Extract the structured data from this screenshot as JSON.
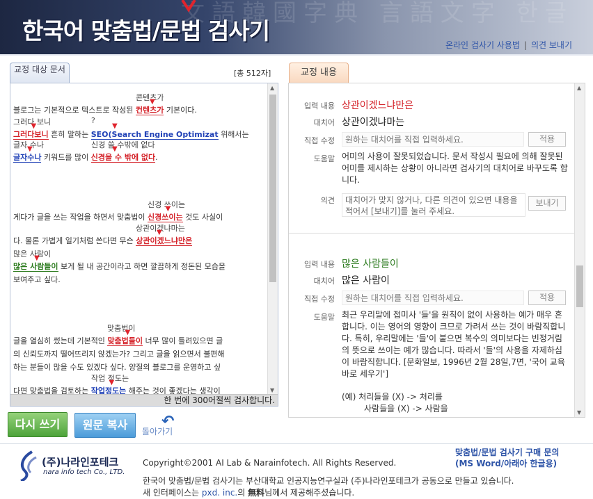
{
  "header": {
    "title_a": "한국어 ",
    "title_b": "맞춤법/문법 검사기",
    "bg_text": "文語韓國字典 言語文字 한글",
    "links": {
      "help": "온라인 검사기 사용법",
      "sep": "|",
      "feedback": "의견 보내기"
    }
  },
  "left": {
    "tab_label": "교정 대상 문서",
    "count": "[총 512자]",
    "status": "한 번에 300어절씩 검사합니다.",
    "lines": [
      {
        "pre": "블로그는 기본적으로 텍스트로 작성된 ",
        "err": "컨텐츠가",
        "type": "red",
        "post": " 기본이다.",
        "sug": "콘텐츠가"
      },
      {
        "pre": "",
        "err": "그러다보니",
        "type": "red",
        "post": " 흔히 말하는 ",
        "err2": "SEO(Search Engine Optimizat",
        "type2": "blue",
        "post2": " 위해서는",
        "sug": "그러다 보니",
        "sug2": "?"
      },
      {
        "pre": "",
        "err": "글자수나",
        "type": "blue",
        "post": " 키워드를 많이 ",
        "err2": "신경을 수 밖에 없다",
        "type2": "red",
        "post2": ".",
        "sug": "글자 수나",
        "sug2": "신경 쓸 수밖에 없다"
      },
      {
        "pre": "게다가 글을 쓰는 작업을 하면서 맞춤법이 ",
        "err": "신경쓰이는",
        "type": "red",
        "post": " 것도 사실이",
        "sug": "신경 쓰이는"
      },
      {
        "pre": "다. 물론 가볍게 일기처럼 쓴다면 무슨 ",
        "err": "상관이겠느냐만은",
        "type": "red",
        "post": "",
        "sug": "상관이겠냐마는"
      },
      {
        "pre": "",
        "err": "많은 사람들이",
        "type": "green",
        "post": " 보게 될 내 공간이라고 하면 깔끔하게 정돈된 모습을",
        "sug": "많은 사람이"
      },
      {
        "pre": "보여주고 싶다.",
        "err": "",
        "type": "",
        "post": ""
      },
      {
        "pre": "글을 열심히 썼는데 기본적인 ",
        "err": "맞춤법들이",
        "type": "red",
        "post": " 너무 많이 틀려있으면 글",
        "sug": "맞춤법이"
      },
      {
        "pre": "의 신뢰도까지 떨어뜨리지 않겠는가? 그리고 글을 읽으면서 불편해",
        "err": "",
        "type": "",
        "post": ""
      },
      {
        "pre": "하는 분들이 많을 수도 있겠다 싶다. 양질의 블로그를 운영하고 싶",
        "err": "",
        "type": "",
        "post": ""
      },
      {
        "pre": "다면 맞춤법을 검토하는 ",
        "err": "작업정도는",
        "type": "blue",
        "post": " 해주는 것이 좋겠다는 생각이",
        "sug": "작업 정도는"
      }
    ]
  },
  "right": {
    "tab_label": "교정 내용",
    "labels": {
      "input": "입력 내용",
      "replace": "대치어",
      "edit": "직접 수정",
      "help": "도움말",
      "opinion": "의견"
    },
    "edit_placeholder": "원하는 대치어를 직접 입력하세요.",
    "apply_label": "적용",
    "send_label": "보내기",
    "opinion_placeholder": "대치어가 맞지 않거나, 다른 의견이 있으면 내용을 적어서 [보내기]를 눌러 주세요.",
    "entries": [
      {
        "input": "상관이겠느냐만은",
        "replace": "상관이겠냐마는",
        "help": "어미의 사용이 잘못되었습니다. 문서 작성시 필요에 의해 잘못된 어미를 제시하는 상황이 아니라면 검사기의 대치어로 바꾸도록 합니다."
      },
      {
        "input": "많은 사람들이",
        "replace": "많은 사람이",
        "help": "최근 우리말에 접미사 '들'을 원칙이 없이 사용하는 예가 매우 흔합니다. 이는 영어의 영향이 크므로 가려서 쓰는 것이 바람직합니다. 특히, 우리말에는 '들'이 붙으면 복수의 의미보다는 빈정거림의 뜻으로 쓰이는 예가 많습니다. 따라서 '들'의 사용을 자제하심이 바람직합니다. [문화일보, 1996년 2월 28일,7면, '국어 교육 바로 세우기']",
        "example": "(예) 처리들을 (X) -> 처리를",
        "example2": "사람들을 (X) -> 사람을"
      }
    ]
  },
  "bottom": {
    "redo": "다시 쓰기",
    "copy": "원문 복사",
    "back": "돌아가기"
  },
  "footer": {
    "company": "(주)나라인포테크",
    "company_en": "nara info tech Co., LTD.",
    "copyright": "Copyright©2001 AI Lab & Narainfotech. All Rights Reserved.",
    "buy1": "맞춤법/문법 검사기 구매 문의",
    "buy2": "(MS Word/아래아 한글용)",
    "credit1": "한국어 맞춤법/문법 검사기는 부산대학교 인공지능연구실과 (주)나라인포테크가 공동으로 만들고 있습니다.",
    "credit2_a": "새 인터페이스는 ",
    "credit2_link": "pxd. inc.",
    "credit2_b": "의 ",
    "credit2_bold": "無料",
    "credit2_c": "님께서 제공해주셨습니다."
  },
  "colors": {
    "error_red": "#d42128",
    "error_blue": "#2041b6",
    "error_green": "#2a7a1c",
    "link": "#2f55a8"
  }
}
